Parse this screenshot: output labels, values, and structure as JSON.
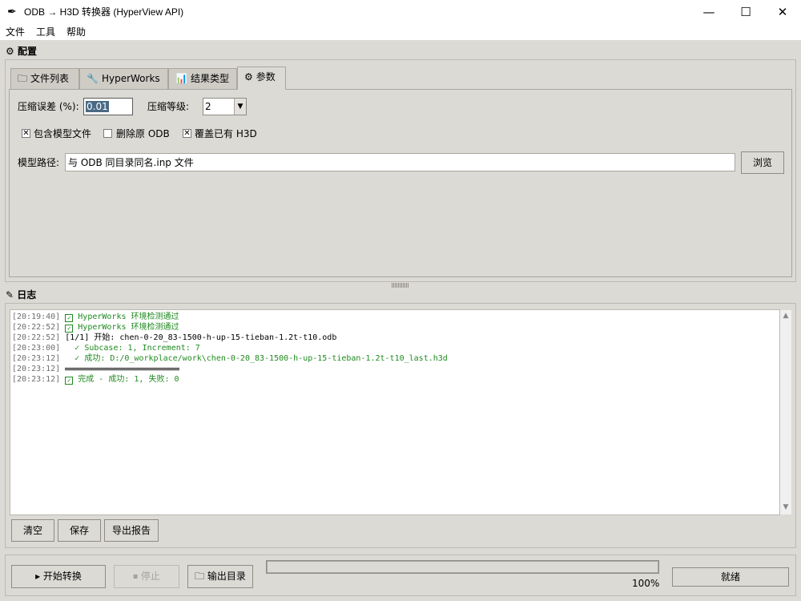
{
  "window": {
    "title": "ODB → H3D 转换器 (HyperView API)",
    "app_icon": "feather-icon",
    "controls": {
      "minimize": "—",
      "maximize": "☐",
      "close": "✕"
    }
  },
  "menu": {
    "items": [
      "文件",
      "工具",
      "帮助"
    ]
  },
  "config": {
    "title": "配置",
    "title_icon": "gear-icon",
    "tabs": [
      {
        "label": "文件列表",
        "icon": "folder-icon",
        "glyph": "🗀"
      },
      {
        "label": "HyperWorks",
        "icon": "wrench-icon",
        "glyph": "🔧"
      },
      {
        "label": "结果类型",
        "icon": "bar-chart-icon",
        "glyph": "📊"
      },
      {
        "label": "参数",
        "icon": "gear-icon",
        "glyph": "⚙",
        "active": true
      }
    ],
    "params": {
      "compress_error_label": "压缩误差 (%):",
      "compress_error_value": "0.01",
      "compress_level_label": "压缩等级:",
      "compress_level_value": "2",
      "checkboxes": [
        {
          "label": "包含模型文件",
          "checked": true
        },
        {
          "label": "删除原 ODB",
          "checked": false
        },
        {
          "label": "覆盖已有 H3D",
          "checked": true
        }
      ],
      "model_path_label": "模型路径:",
      "model_path_value": "与 ODB 同目录同名.inp 文件",
      "browse_label": "浏览"
    }
  },
  "log": {
    "title": "日志",
    "title_icon": "edit-icon",
    "lines": [
      {
        "ts": "[20:19:40]",
        "icon": "☑",
        "text": "HyperWorks 环境检测通过",
        "color": "green"
      },
      {
        "ts": "[20:22:52]",
        "icon": "☑",
        "text": "HyperWorks 环境检测通过",
        "color": "green"
      },
      {
        "ts": "[20:22:52]",
        "icon": "",
        "text": "[1/1] 开始: chen-0-20_83-1500-h-up-15-tieban-1.2t-t10.odb",
        "color": "black"
      },
      {
        "ts": "[20:23:00]",
        "icon": "",
        "text": "  ✓ Subcase: 1, Increment: 7",
        "color": "green"
      },
      {
        "ts": "[20:23:12]",
        "icon": "",
        "text": "  ✓ 成功: D:/0_workplace/work\\chen-0-20_83-1500-h-up-15-tieban-1.2t-t10_last.h3d",
        "color": "green"
      },
      {
        "ts": "[20:23:12]",
        "icon": "",
        "text": "",
        "color": "separator"
      },
      {
        "ts": "[20:23:12]",
        "icon": "☑",
        "text": "完成 - 成功: 1, 失败: 0",
        "color": "green"
      }
    ],
    "buttons": {
      "clear": "清空",
      "save": "保存",
      "export": "导出报告"
    }
  },
  "bottom": {
    "start_label": "▸ 开始转换",
    "stop_label": "⏹ 停止",
    "output_dir_label": "🗀 输出目录",
    "progress_percent": 100,
    "progress_label": "100%",
    "status": "就绪"
  }
}
